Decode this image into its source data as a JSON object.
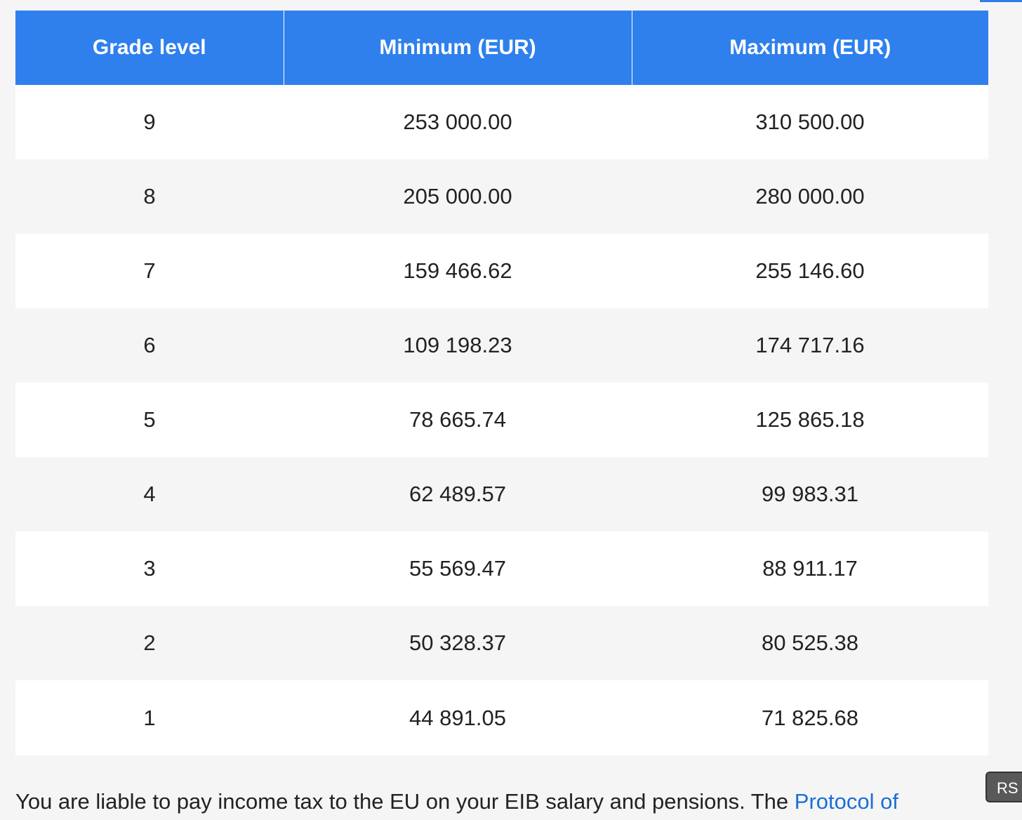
{
  "table": {
    "headers": [
      "Grade level",
      "Minimum (EUR)",
      "Maximum (EUR)"
    ],
    "rows": [
      [
        "9",
        "253 000.00",
        "310 500.00"
      ],
      [
        "8",
        "205 000.00",
        "280 000.00"
      ],
      [
        "7",
        "159 466.62",
        "255 146.60"
      ],
      [
        "6",
        "109 198.23",
        "174 717.16"
      ],
      [
        "5",
        "78 665.74",
        "125 865.18"
      ],
      [
        "4",
        "62 489.57",
        "99 983.31"
      ],
      [
        "3",
        "55 569.47",
        "88 911.17"
      ],
      [
        "2",
        "50 328.37",
        "80 525.38"
      ],
      [
        "1",
        "44 891.05",
        "71 825.68"
      ]
    ]
  },
  "footer": {
    "text": "You are liable to pay income tax to the EU on your EIB salary and pensions. The ",
    "link_text": "Protocol of"
  },
  "rs_button": {
    "label": "RS"
  },
  "colors": {
    "header_bg": "#2f80ed",
    "link": "#1a6fd8",
    "row_alt": "#f5f5f5"
  }
}
